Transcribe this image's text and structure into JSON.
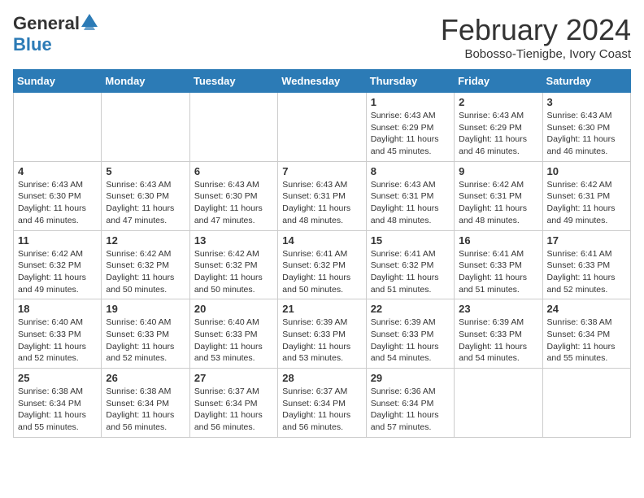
{
  "header": {
    "logo_general": "General",
    "logo_blue": "Blue",
    "month_title": "February 2024",
    "subtitle": "Bobosso-Tienigbe, Ivory Coast"
  },
  "weekdays": [
    "Sunday",
    "Monday",
    "Tuesday",
    "Wednesday",
    "Thursday",
    "Friday",
    "Saturday"
  ],
  "weeks": [
    [
      {
        "day": "",
        "info": ""
      },
      {
        "day": "",
        "info": ""
      },
      {
        "day": "",
        "info": ""
      },
      {
        "day": "",
        "info": ""
      },
      {
        "day": "1",
        "info": "Sunrise: 6:43 AM\nSunset: 6:29 PM\nDaylight: 11 hours\nand 45 minutes."
      },
      {
        "day": "2",
        "info": "Sunrise: 6:43 AM\nSunset: 6:29 PM\nDaylight: 11 hours\nand 46 minutes."
      },
      {
        "day": "3",
        "info": "Sunrise: 6:43 AM\nSunset: 6:30 PM\nDaylight: 11 hours\nand 46 minutes."
      }
    ],
    [
      {
        "day": "4",
        "info": "Sunrise: 6:43 AM\nSunset: 6:30 PM\nDaylight: 11 hours\nand 46 minutes."
      },
      {
        "day": "5",
        "info": "Sunrise: 6:43 AM\nSunset: 6:30 PM\nDaylight: 11 hours\nand 47 minutes."
      },
      {
        "day": "6",
        "info": "Sunrise: 6:43 AM\nSunset: 6:30 PM\nDaylight: 11 hours\nand 47 minutes."
      },
      {
        "day": "7",
        "info": "Sunrise: 6:43 AM\nSunset: 6:31 PM\nDaylight: 11 hours\nand 48 minutes."
      },
      {
        "day": "8",
        "info": "Sunrise: 6:43 AM\nSunset: 6:31 PM\nDaylight: 11 hours\nand 48 minutes."
      },
      {
        "day": "9",
        "info": "Sunrise: 6:42 AM\nSunset: 6:31 PM\nDaylight: 11 hours\nand 48 minutes."
      },
      {
        "day": "10",
        "info": "Sunrise: 6:42 AM\nSunset: 6:31 PM\nDaylight: 11 hours\nand 49 minutes."
      }
    ],
    [
      {
        "day": "11",
        "info": "Sunrise: 6:42 AM\nSunset: 6:32 PM\nDaylight: 11 hours\nand 49 minutes."
      },
      {
        "day": "12",
        "info": "Sunrise: 6:42 AM\nSunset: 6:32 PM\nDaylight: 11 hours\nand 50 minutes."
      },
      {
        "day": "13",
        "info": "Sunrise: 6:42 AM\nSunset: 6:32 PM\nDaylight: 11 hours\nand 50 minutes."
      },
      {
        "day": "14",
        "info": "Sunrise: 6:41 AM\nSunset: 6:32 PM\nDaylight: 11 hours\nand 50 minutes."
      },
      {
        "day": "15",
        "info": "Sunrise: 6:41 AM\nSunset: 6:32 PM\nDaylight: 11 hours\nand 51 minutes."
      },
      {
        "day": "16",
        "info": "Sunrise: 6:41 AM\nSunset: 6:33 PM\nDaylight: 11 hours\nand 51 minutes."
      },
      {
        "day": "17",
        "info": "Sunrise: 6:41 AM\nSunset: 6:33 PM\nDaylight: 11 hours\nand 52 minutes."
      }
    ],
    [
      {
        "day": "18",
        "info": "Sunrise: 6:40 AM\nSunset: 6:33 PM\nDaylight: 11 hours\nand 52 minutes."
      },
      {
        "day": "19",
        "info": "Sunrise: 6:40 AM\nSunset: 6:33 PM\nDaylight: 11 hours\nand 52 minutes."
      },
      {
        "day": "20",
        "info": "Sunrise: 6:40 AM\nSunset: 6:33 PM\nDaylight: 11 hours\nand 53 minutes."
      },
      {
        "day": "21",
        "info": "Sunrise: 6:39 AM\nSunset: 6:33 PM\nDaylight: 11 hours\nand 53 minutes."
      },
      {
        "day": "22",
        "info": "Sunrise: 6:39 AM\nSunset: 6:33 PM\nDaylight: 11 hours\nand 54 minutes."
      },
      {
        "day": "23",
        "info": "Sunrise: 6:39 AM\nSunset: 6:33 PM\nDaylight: 11 hours\nand 54 minutes."
      },
      {
        "day": "24",
        "info": "Sunrise: 6:38 AM\nSunset: 6:34 PM\nDaylight: 11 hours\nand 55 minutes."
      }
    ],
    [
      {
        "day": "25",
        "info": "Sunrise: 6:38 AM\nSunset: 6:34 PM\nDaylight: 11 hours\nand 55 minutes."
      },
      {
        "day": "26",
        "info": "Sunrise: 6:38 AM\nSunset: 6:34 PM\nDaylight: 11 hours\nand 56 minutes."
      },
      {
        "day": "27",
        "info": "Sunrise: 6:37 AM\nSunset: 6:34 PM\nDaylight: 11 hours\nand 56 minutes."
      },
      {
        "day": "28",
        "info": "Sunrise: 6:37 AM\nSunset: 6:34 PM\nDaylight: 11 hours\nand 56 minutes."
      },
      {
        "day": "29",
        "info": "Sunrise: 6:36 AM\nSunset: 6:34 PM\nDaylight: 11 hours\nand 57 minutes."
      },
      {
        "day": "",
        "info": ""
      },
      {
        "day": "",
        "info": ""
      }
    ]
  ]
}
